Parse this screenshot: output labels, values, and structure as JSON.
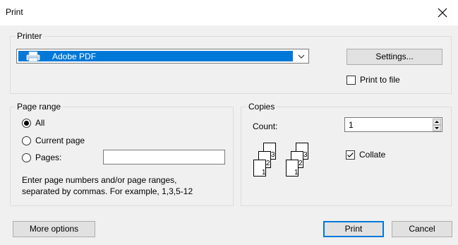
{
  "window": {
    "title": "Print"
  },
  "printer_group": {
    "legend": "Printer",
    "selected_printer": "Adobe PDF",
    "settings_label": "Settings...",
    "print_to_file_label": "Print to file",
    "print_to_file_checked": false
  },
  "page_range": {
    "legend": "Page range",
    "options": [
      {
        "label": "All",
        "selected": true
      },
      {
        "label": "Current page",
        "selected": false
      },
      {
        "label": "Pages:",
        "selected": false
      }
    ],
    "pages_value": "",
    "hint_line1": "Enter page numbers and/or page ranges,",
    "hint_line2": "separated by commas. For example, 1,3,5-12"
  },
  "copies": {
    "legend": "Copies",
    "count_label": "Count:",
    "count_value": "1",
    "collate_label": "Collate",
    "collate_checked": true,
    "page_numbers": [
      "1",
      "2",
      "3"
    ]
  },
  "footer": {
    "more_options_label": "More options",
    "print_label": "Print",
    "cancel_label": "Cancel"
  },
  "colors": {
    "accent": "#0078d7",
    "dialog_bg": "#f0f0f0"
  },
  "icons": [
    "close-icon",
    "printer-icon",
    "chevron-down-icon",
    "spin-up-icon",
    "spin-down-icon",
    "checkmark-icon"
  ]
}
